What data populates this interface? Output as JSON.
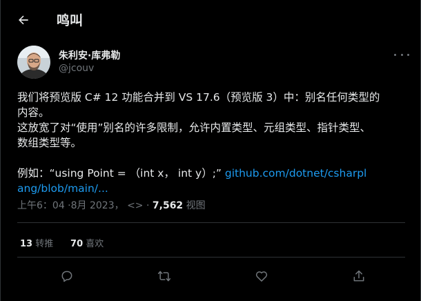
{
  "header": {
    "title": "鸣叫",
    "back_icon": "arrow-left-icon"
  },
  "author": {
    "name": "朱利安·库弗勒",
    "handle": "@jcouv"
  },
  "tweet": {
    "lines": [
      "我们将预览版 C# 12 功能合并到 VS 17.6（预览版 3）中：别名任何类型的",
      "内容。",
      "这放宽了对“使用”别名的许多限制，允许内置类型、元组类型、指针类型、",
      "数组类型等。"
    ],
    "example_prefix": "例如：“using Point = （int x， int y）;”",
    "link_line1": "github.com/dotnet/csharpl",
    "link_line2": "ang/blob/main/..."
  },
  "meta": {
    "time": "上午6：04 ·8月 2023，",
    "code": "<>",
    "dot": "·",
    "views_count": "7,562",
    "views_label": "视图"
  },
  "stats": {
    "retweets_count": "13",
    "retweets_label": "转推",
    "likes_count": "70",
    "likes_label": "喜欢"
  },
  "actions": [
    "reply-icon",
    "retweet-icon",
    "like-icon",
    "share-icon"
  ],
  "colors": {
    "background": "#000000",
    "text": "#e7e9ea",
    "muted": "#71767b",
    "link": "#1d9bf0",
    "border": "#2f3336"
  }
}
